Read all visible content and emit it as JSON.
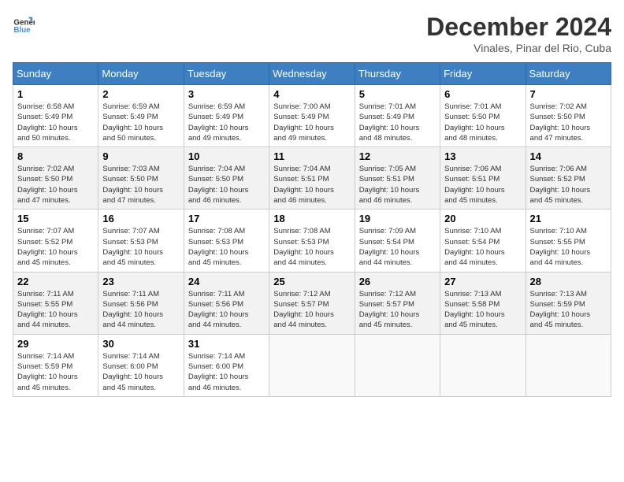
{
  "logo": {
    "line1": "General",
    "line2": "Blue"
  },
  "title": "December 2024",
  "subtitle": "Vinales, Pinar del Rio, Cuba",
  "weekdays": [
    "Sunday",
    "Monday",
    "Tuesday",
    "Wednesday",
    "Thursday",
    "Friday",
    "Saturday"
  ],
  "weeks": [
    [
      {
        "day": "1",
        "info": "Sunrise: 6:58 AM\nSunset: 5:49 PM\nDaylight: 10 hours\nand 50 minutes."
      },
      {
        "day": "2",
        "info": "Sunrise: 6:59 AM\nSunset: 5:49 PM\nDaylight: 10 hours\nand 50 minutes."
      },
      {
        "day": "3",
        "info": "Sunrise: 6:59 AM\nSunset: 5:49 PM\nDaylight: 10 hours\nand 49 minutes."
      },
      {
        "day": "4",
        "info": "Sunrise: 7:00 AM\nSunset: 5:49 PM\nDaylight: 10 hours\nand 49 minutes."
      },
      {
        "day": "5",
        "info": "Sunrise: 7:01 AM\nSunset: 5:49 PM\nDaylight: 10 hours\nand 48 minutes."
      },
      {
        "day": "6",
        "info": "Sunrise: 7:01 AM\nSunset: 5:50 PM\nDaylight: 10 hours\nand 48 minutes."
      },
      {
        "day": "7",
        "info": "Sunrise: 7:02 AM\nSunset: 5:50 PM\nDaylight: 10 hours\nand 47 minutes."
      }
    ],
    [
      {
        "day": "8",
        "info": "Sunrise: 7:02 AM\nSunset: 5:50 PM\nDaylight: 10 hours\nand 47 minutes."
      },
      {
        "day": "9",
        "info": "Sunrise: 7:03 AM\nSunset: 5:50 PM\nDaylight: 10 hours\nand 47 minutes."
      },
      {
        "day": "10",
        "info": "Sunrise: 7:04 AM\nSunset: 5:50 PM\nDaylight: 10 hours\nand 46 minutes."
      },
      {
        "day": "11",
        "info": "Sunrise: 7:04 AM\nSunset: 5:51 PM\nDaylight: 10 hours\nand 46 minutes."
      },
      {
        "day": "12",
        "info": "Sunrise: 7:05 AM\nSunset: 5:51 PM\nDaylight: 10 hours\nand 46 minutes."
      },
      {
        "day": "13",
        "info": "Sunrise: 7:06 AM\nSunset: 5:51 PM\nDaylight: 10 hours\nand 45 minutes."
      },
      {
        "day": "14",
        "info": "Sunrise: 7:06 AM\nSunset: 5:52 PM\nDaylight: 10 hours\nand 45 minutes."
      }
    ],
    [
      {
        "day": "15",
        "info": "Sunrise: 7:07 AM\nSunset: 5:52 PM\nDaylight: 10 hours\nand 45 minutes."
      },
      {
        "day": "16",
        "info": "Sunrise: 7:07 AM\nSunset: 5:53 PM\nDaylight: 10 hours\nand 45 minutes."
      },
      {
        "day": "17",
        "info": "Sunrise: 7:08 AM\nSunset: 5:53 PM\nDaylight: 10 hours\nand 45 minutes."
      },
      {
        "day": "18",
        "info": "Sunrise: 7:08 AM\nSunset: 5:53 PM\nDaylight: 10 hours\nand 44 minutes."
      },
      {
        "day": "19",
        "info": "Sunrise: 7:09 AM\nSunset: 5:54 PM\nDaylight: 10 hours\nand 44 minutes."
      },
      {
        "day": "20",
        "info": "Sunrise: 7:10 AM\nSunset: 5:54 PM\nDaylight: 10 hours\nand 44 minutes."
      },
      {
        "day": "21",
        "info": "Sunrise: 7:10 AM\nSunset: 5:55 PM\nDaylight: 10 hours\nand 44 minutes."
      }
    ],
    [
      {
        "day": "22",
        "info": "Sunrise: 7:11 AM\nSunset: 5:55 PM\nDaylight: 10 hours\nand 44 minutes."
      },
      {
        "day": "23",
        "info": "Sunrise: 7:11 AM\nSunset: 5:56 PM\nDaylight: 10 hours\nand 44 minutes."
      },
      {
        "day": "24",
        "info": "Sunrise: 7:11 AM\nSunset: 5:56 PM\nDaylight: 10 hours\nand 44 minutes."
      },
      {
        "day": "25",
        "info": "Sunrise: 7:12 AM\nSunset: 5:57 PM\nDaylight: 10 hours\nand 44 minutes."
      },
      {
        "day": "26",
        "info": "Sunrise: 7:12 AM\nSunset: 5:57 PM\nDaylight: 10 hours\nand 45 minutes."
      },
      {
        "day": "27",
        "info": "Sunrise: 7:13 AM\nSunset: 5:58 PM\nDaylight: 10 hours\nand 45 minutes."
      },
      {
        "day": "28",
        "info": "Sunrise: 7:13 AM\nSunset: 5:59 PM\nDaylight: 10 hours\nand 45 minutes."
      }
    ],
    [
      {
        "day": "29",
        "info": "Sunrise: 7:14 AM\nSunset: 5:59 PM\nDaylight: 10 hours\nand 45 minutes."
      },
      {
        "day": "30",
        "info": "Sunrise: 7:14 AM\nSunset: 6:00 PM\nDaylight: 10 hours\nand 45 minutes."
      },
      {
        "day": "31",
        "info": "Sunrise: 7:14 AM\nSunset: 6:00 PM\nDaylight: 10 hours\nand 46 minutes."
      },
      null,
      null,
      null,
      null
    ]
  ]
}
